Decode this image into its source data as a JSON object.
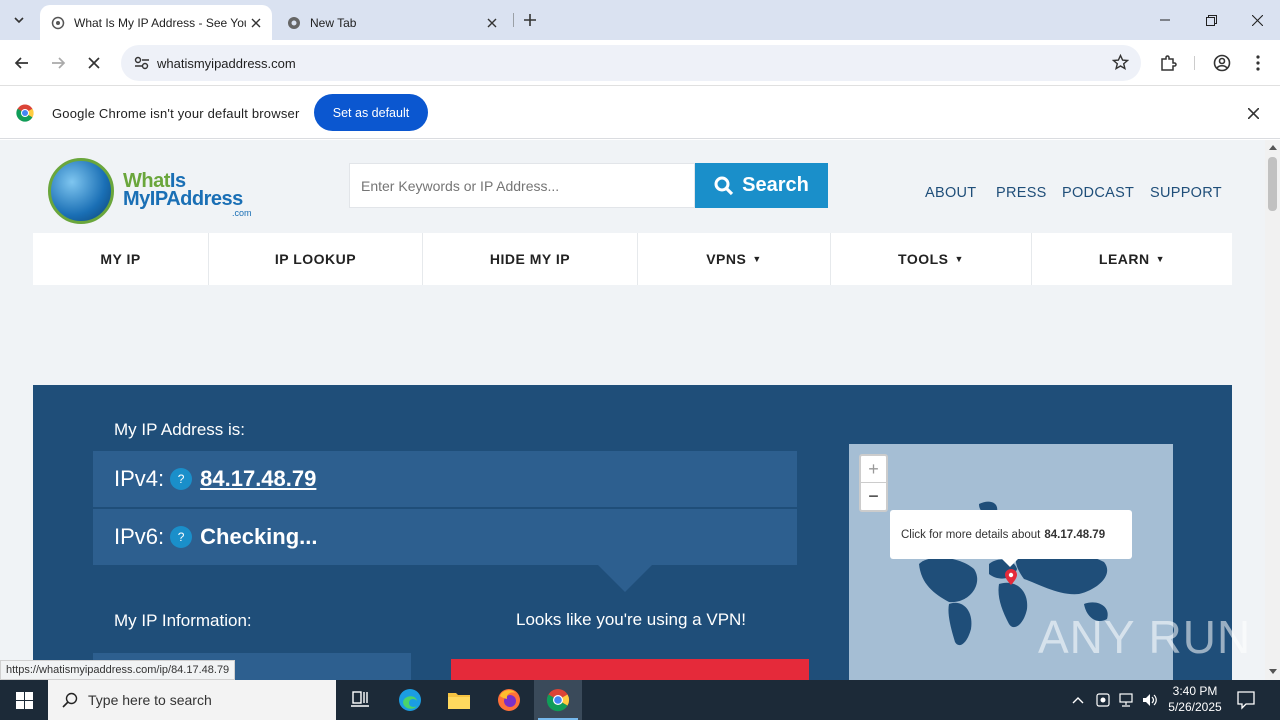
{
  "browser": {
    "tabs": [
      {
        "title": "What Is My IP Address - See Your",
        "active": true
      },
      {
        "title": "New Tab",
        "active": false
      }
    ],
    "url": "whatismyipaddress.com",
    "infobar": {
      "message": "Google Chrome isn't your default browser",
      "button": "Set as default"
    },
    "status_url": "https://whatismyipaddress.com/ip/84.17.48.79"
  },
  "site": {
    "logo": {
      "line1a": "What",
      "line1b": "Is",
      "line2": "MyIPAddress",
      "line3": ".com"
    },
    "search": {
      "placeholder": "Enter Keywords or IP Address...",
      "button": "Search"
    },
    "top_links": [
      "ABOUT",
      "PRESS",
      "PODCAST",
      "SUPPORT"
    ],
    "nav": [
      {
        "label": "MY IP",
        "caret": false
      },
      {
        "label": "IP LOOKUP",
        "caret": false
      },
      {
        "label": "HIDE MY IP",
        "caret": false
      },
      {
        "label": "VPNS",
        "caret": true
      },
      {
        "label": "TOOLS",
        "caret": true
      },
      {
        "label": "LEARN",
        "caret": true
      }
    ],
    "hero": {
      "heading": "My IP Address is:",
      "ipv4_label": "IPv4:",
      "ipv4_value": "84.17.48.79",
      "ipv6_label": "IPv6:",
      "ipv6_value": "Checking...",
      "info_heading": "My IP Information:",
      "vpn_message": "Looks like you're using a VPN!",
      "help_glyph": "?"
    },
    "map": {
      "zoom_in": "+",
      "zoom_out": "−",
      "popup_text": "Click for more details about",
      "popup_ip": "84.17.48.79"
    }
  },
  "watermark": "ANY RUN",
  "taskbar": {
    "search_placeholder": "Type here to search",
    "time": "3:40 PM",
    "date": "5/26/2025"
  },
  "colors": {
    "brand_blue": "#1f4e79",
    "accent": "#1a8fca",
    "vpn_red": "#e52a3a",
    "chrome_button": "#0b57d0"
  }
}
